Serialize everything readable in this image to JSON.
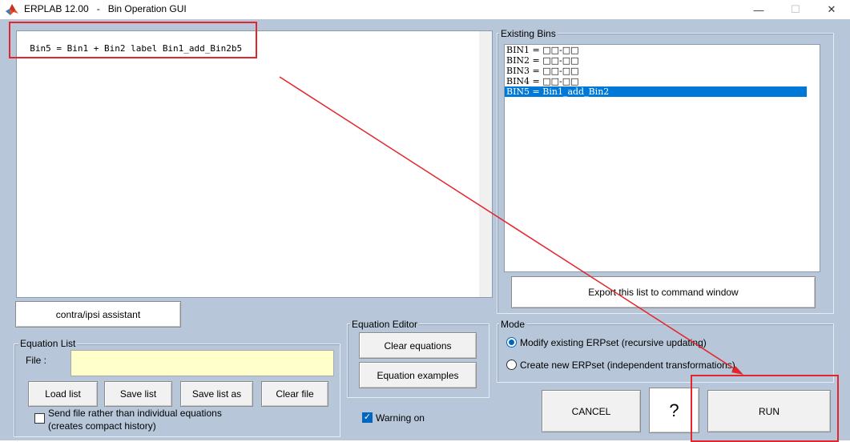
{
  "window": {
    "title": "ERPLAB 12.00   -   Bin Operation GUI",
    "minimize": "—",
    "maximize": "☐",
    "close": "✕"
  },
  "editor": {
    "content": "Bin5 = Bin1 + Bin2 label Bin1_add_Bin2b5"
  },
  "existing_bins": {
    "label": "Existing Bins",
    "items": [
      "BIN1 = □□-□□",
      "BIN2 = □□-□□",
      "BIN3 = □□-□□",
      "BIN4 = □□-□□",
      "BIN5 = Bin1_add_Bin2"
    ],
    "selected_index": 4,
    "export_label": "Export this list to command window"
  },
  "contra_ipsi_label": "contra/ipsi assistant",
  "equation_list": {
    "label": "Equation List",
    "file_label": "File :",
    "file_value": "",
    "load_label": "Load list",
    "save_label": "Save list",
    "save_as_label": "Save list as",
    "clear_file_label": "Clear file",
    "send_file_line1": "Send file rather than individual equations",
    "send_file_line2": "(creates compact history)",
    "send_file_checked": false
  },
  "equation_editor": {
    "label": "Equation Editor",
    "clear_label": "Clear equations",
    "examples_label": "Equation examples"
  },
  "warning": {
    "label": "Warning on",
    "checked": true
  },
  "mode": {
    "label": "Mode",
    "options": [
      "Modify existing ERPset (recursive updating)",
      "Create new ERPset (independent transformations)"
    ],
    "selected_index": 0
  },
  "actions": {
    "cancel_label": "CANCEL",
    "help_label": "?",
    "run_label": "RUN"
  },
  "colors": {
    "background": "#b7c7d9",
    "selection": "#0078d7",
    "annotation": "#e5252d",
    "file_field": "#ffffcc"
  }
}
